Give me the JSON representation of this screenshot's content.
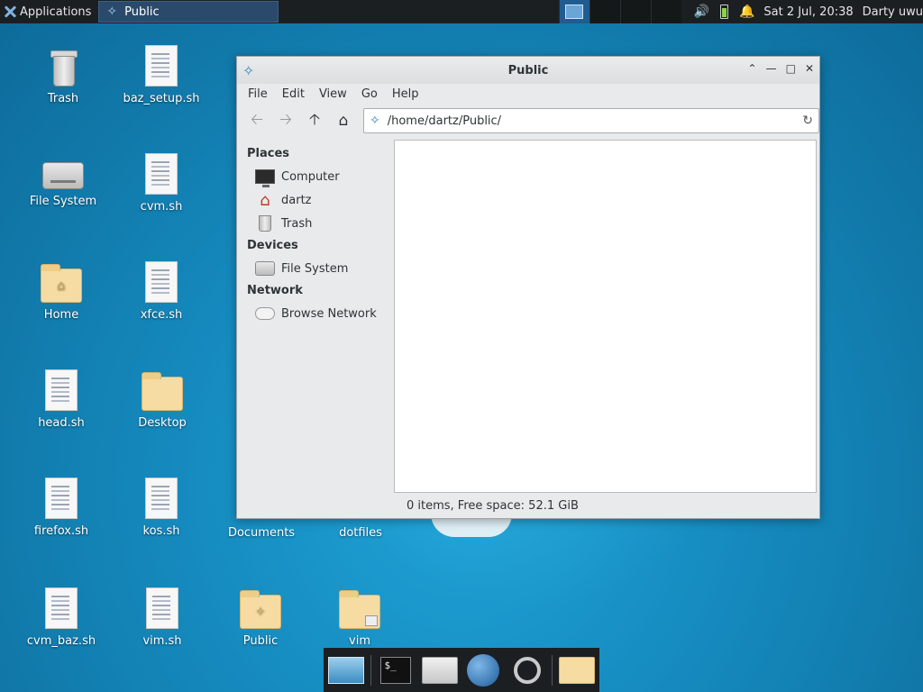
{
  "top_panel": {
    "applications_label": "Applications",
    "task_title": "Public",
    "clock": "Sat  2 Jul, 20:38",
    "user": "Darty uwu"
  },
  "desktop_icons": [
    {
      "label": "Trash",
      "type": "trash"
    },
    {
      "label": "baz_setup.sh",
      "type": "doc"
    },
    {
      "label": "File System",
      "type": "drive"
    },
    {
      "label": "cvm.sh",
      "type": "doc"
    },
    {
      "label": "Home",
      "type": "folder-home"
    },
    {
      "label": "xfce.sh",
      "type": "doc"
    },
    {
      "label": "head.sh",
      "type": "doc"
    },
    {
      "label": "Desktop",
      "type": "folder"
    },
    {
      "label": "firefox.sh",
      "type": "doc"
    },
    {
      "label": "kos.sh",
      "type": "doc"
    },
    {
      "label": "Documents",
      "type": "folder"
    },
    {
      "label": "dotfiles",
      "type": "folder"
    },
    {
      "label": "cvm_baz.sh",
      "type": "doc"
    },
    {
      "label": "vim.sh",
      "type": "doc"
    },
    {
      "label": "Public",
      "type": "folder-share"
    },
    {
      "label": "vim",
      "type": "folder-locked"
    }
  ],
  "window": {
    "title": "Public",
    "menu": [
      "File",
      "Edit",
      "View",
      "Go",
      "Help"
    ],
    "location": "/home/dartz/Public/",
    "sidebar": {
      "places_header": "Places",
      "places": [
        "Computer",
        "dartz",
        "Trash"
      ],
      "devices_header": "Devices",
      "devices": [
        "File System"
      ],
      "network_header": "Network",
      "network": [
        "Browse Network"
      ]
    },
    "status": "0 items, Free space: 52.1 GiB"
  },
  "dock": {
    "terminal_glyph": "$_"
  }
}
